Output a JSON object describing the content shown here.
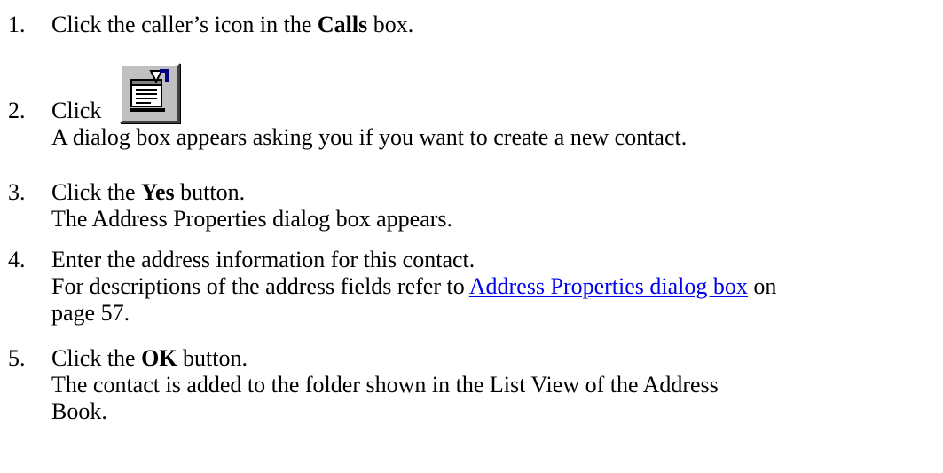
{
  "steps": [
    {
      "number": "1.",
      "parts": [
        "Click the caller’s icon in the ",
        "Calls",
        " box."
      ]
    },
    {
      "number": "2.",
      "click_label": "Click",
      "period": ".",
      "icon": "new-contact-icon",
      "note": "A dialog box appears asking you if you want to create a new contact."
    },
    {
      "number": "3.",
      "parts": [
        "Click the ",
        "Yes",
        " button."
      ],
      "note": "The Address Properties dialog box appears."
    },
    {
      "number": "4.",
      "text": "Enter the address information for this contact.",
      "note_prefix": "For descriptions of the address fields refer to ",
      "link_text": "Address Properties dialog box",
      "note_suffix": " on",
      "note_line2": "page 57."
    },
    {
      "number": "5.",
      "parts": [
        "Click the ",
        "OK",
        " button."
      ],
      "note_line1": "The contact is added to the folder shown in the List View of the Address",
      "note_line2": "Book."
    }
  ],
  "colors": {
    "text": "#000000",
    "link": "#0000ee",
    "button_face": "#c0c0c0"
  }
}
